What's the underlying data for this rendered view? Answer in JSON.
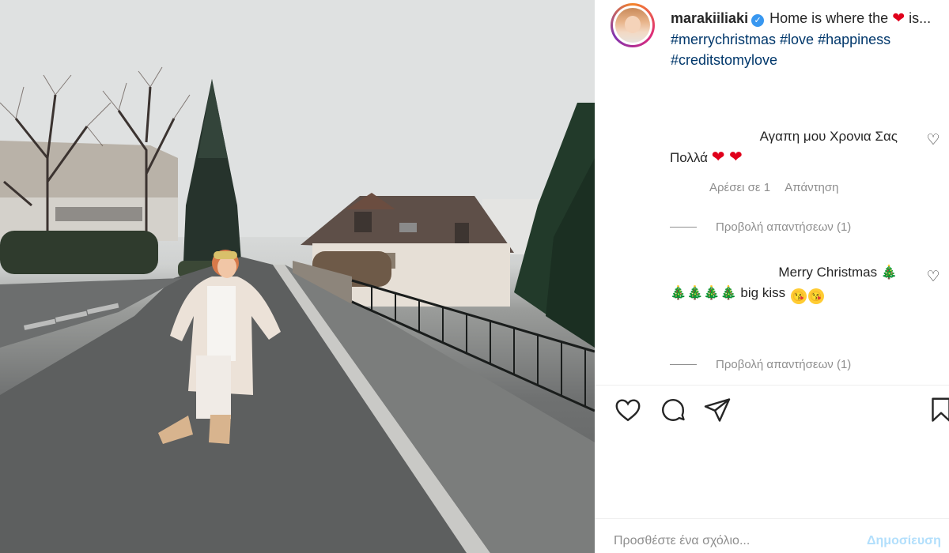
{
  "post": {
    "image_alt": "",
    "username": "marakiiliaki",
    "verified": true,
    "caption_prefix": "Home is where the",
    "caption_heart": "❤",
    "caption_suffix": "is...",
    "hashtags": [
      "#merrychristmas",
      "#love",
      "#happiness",
      "#creditstomylove"
    ]
  },
  "comments": [
    {
      "line1": "Αγαπη μου Χρονια Σας",
      "line2": "Πολλά",
      "emoji": "❤ ❤",
      "likes_label": "Αρέσει σε 1",
      "reply_label": "Απάντηση",
      "view_replies": "Προβολή απαντήσεων (1)"
    },
    {
      "line1": "Merry Christmas",
      "line1_emoji": "🎄",
      "line2_emoji": "🎄🎄🎄🎄",
      "line2": "big kiss",
      "view_replies": "Προβολή απαντήσεων (1)"
    }
  ],
  "icons": {
    "like": "heart-icon",
    "comment": "comment-icon",
    "share": "paper-plane-icon",
    "save": "bookmark-icon",
    "comment_like": "small-heart-icon"
  },
  "composer": {
    "placeholder": "Προσθέστε ένα σχόλιο...",
    "post_label": "Δημοσίευση"
  },
  "colors": {
    "hashtag": "#00376b",
    "verified": "#3897f0",
    "muted": "#8e8e8e",
    "post_button": "#b2dffc"
  }
}
